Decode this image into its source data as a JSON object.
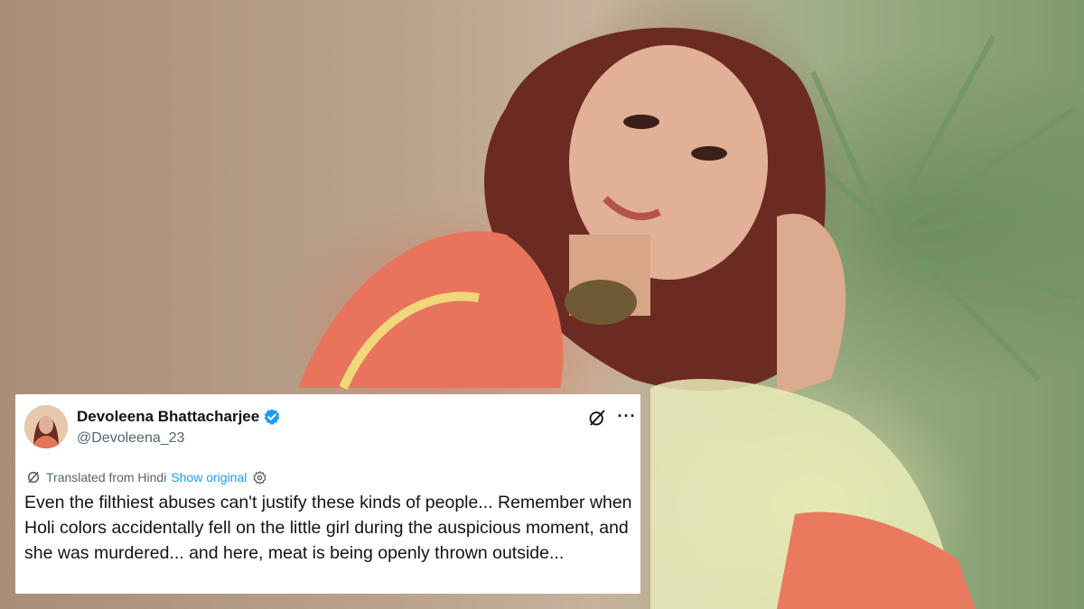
{
  "tweet": {
    "author_name": "Devoleena Bhattacharjee",
    "handle": "@Devoleena_23",
    "verified": true,
    "translated_label": "Translated from Hindi",
    "show_original_label": "Show original",
    "more_label": "···",
    "text": "Even the filthiest abuses can't justify these kinds of people... Remember when Holi colors accidentally fell on the little girl during the auspicious moment, and she was murdered... and here, meat is being openly thrown outside...",
    "icons": [
      "verified-badge-icon",
      "grok-icon",
      "more-icon",
      "translate-icon",
      "gear-icon"
    ]
  },
  "colors": {
    "text_primary": "#0f1419",
    "text_secondary": "#536471",
    "link": "#1d9bf0",
    "verified": "#1d9bf0"
  }
}
